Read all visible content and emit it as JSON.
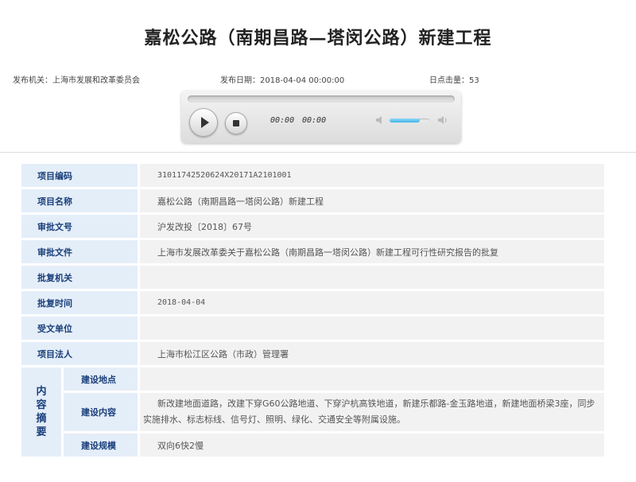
{
  "page": {
    "title": "嘉松公路（南期昌路—塔闵公路）新建工程",
    "issuer_label": "发布机关：",
    "issuer": "上海市发展和改革委员会",
    "date_label": "发布日期：",
    "date": "2018-04-04 00:00:00",
    "clicks_label": "日点击量：",
    "clicks": "53"
  },
  "player": {
    "current_time": "00:00",
    "duration": "00:00",
    "volume_level": 0.75,
    "progress": 0,
    "icons": {
      "play": "play-icon",
      "stop": "stop-icon",
      "mute": "volume-mute-icon",
      "max": "volume-max-icon"
    }
  },
  "info": {
    "rows": [
      {
        "label": "项目编码",
        "value": "31011742520624X20171A2101001"
      },
      {
        "label": "项目名称",
        "value": "嘉松公路（南期昌路一塔闵公路）新建工程"
      },
      {
        "label": "审批文号",
        "value": "沪发改投〔2018〕67号"
      },
      {
        "label": "审批文件",
        "value": "上海市发展改革委关于嘉松公路（南期昌路一塔闵公路）新建工程可行性研究报告的批复"
      },
      {
        "label": "批复机关",
        "value": ""
      },
      {
        "label": "批复时间",
        "value": "2018-04-04"
      },
      {
        "label": "受文单位",
        "value": ""
      },
      {
        "label": "项目法人",
        "value": "上海市松江区公路（市政）管理署"
      }
    ],
    "summary_section": "内容摘要",
    "summary_section_chars": [
      "内",
      "容",
      "摘",
      "要"
    ],
    "summary": [
      {
        "label": "建设地点",
        "value": ""
      },
      {
        "label": "建设内容",
        "value": "新改建地面道路，改建下穿G60公路地道、下穿沪杭高铁地道，新建乐都路-金玉路地道，新建地面桥梁3座，同步实施排水、标志标线、信号灯、照明、绿化、交通安全等附属设施。"
      },
      {
        "label": "建设规模",
        "value": "双向6快2慢"
      }
    ]
  },
  "colors": {
    "label_bg": "#e4eef9",
    "label_text": "#1a3f7a",
    "value_bg": "#f2f2f2",
    "volume_fill": "#3fb3e8"
  }
}
